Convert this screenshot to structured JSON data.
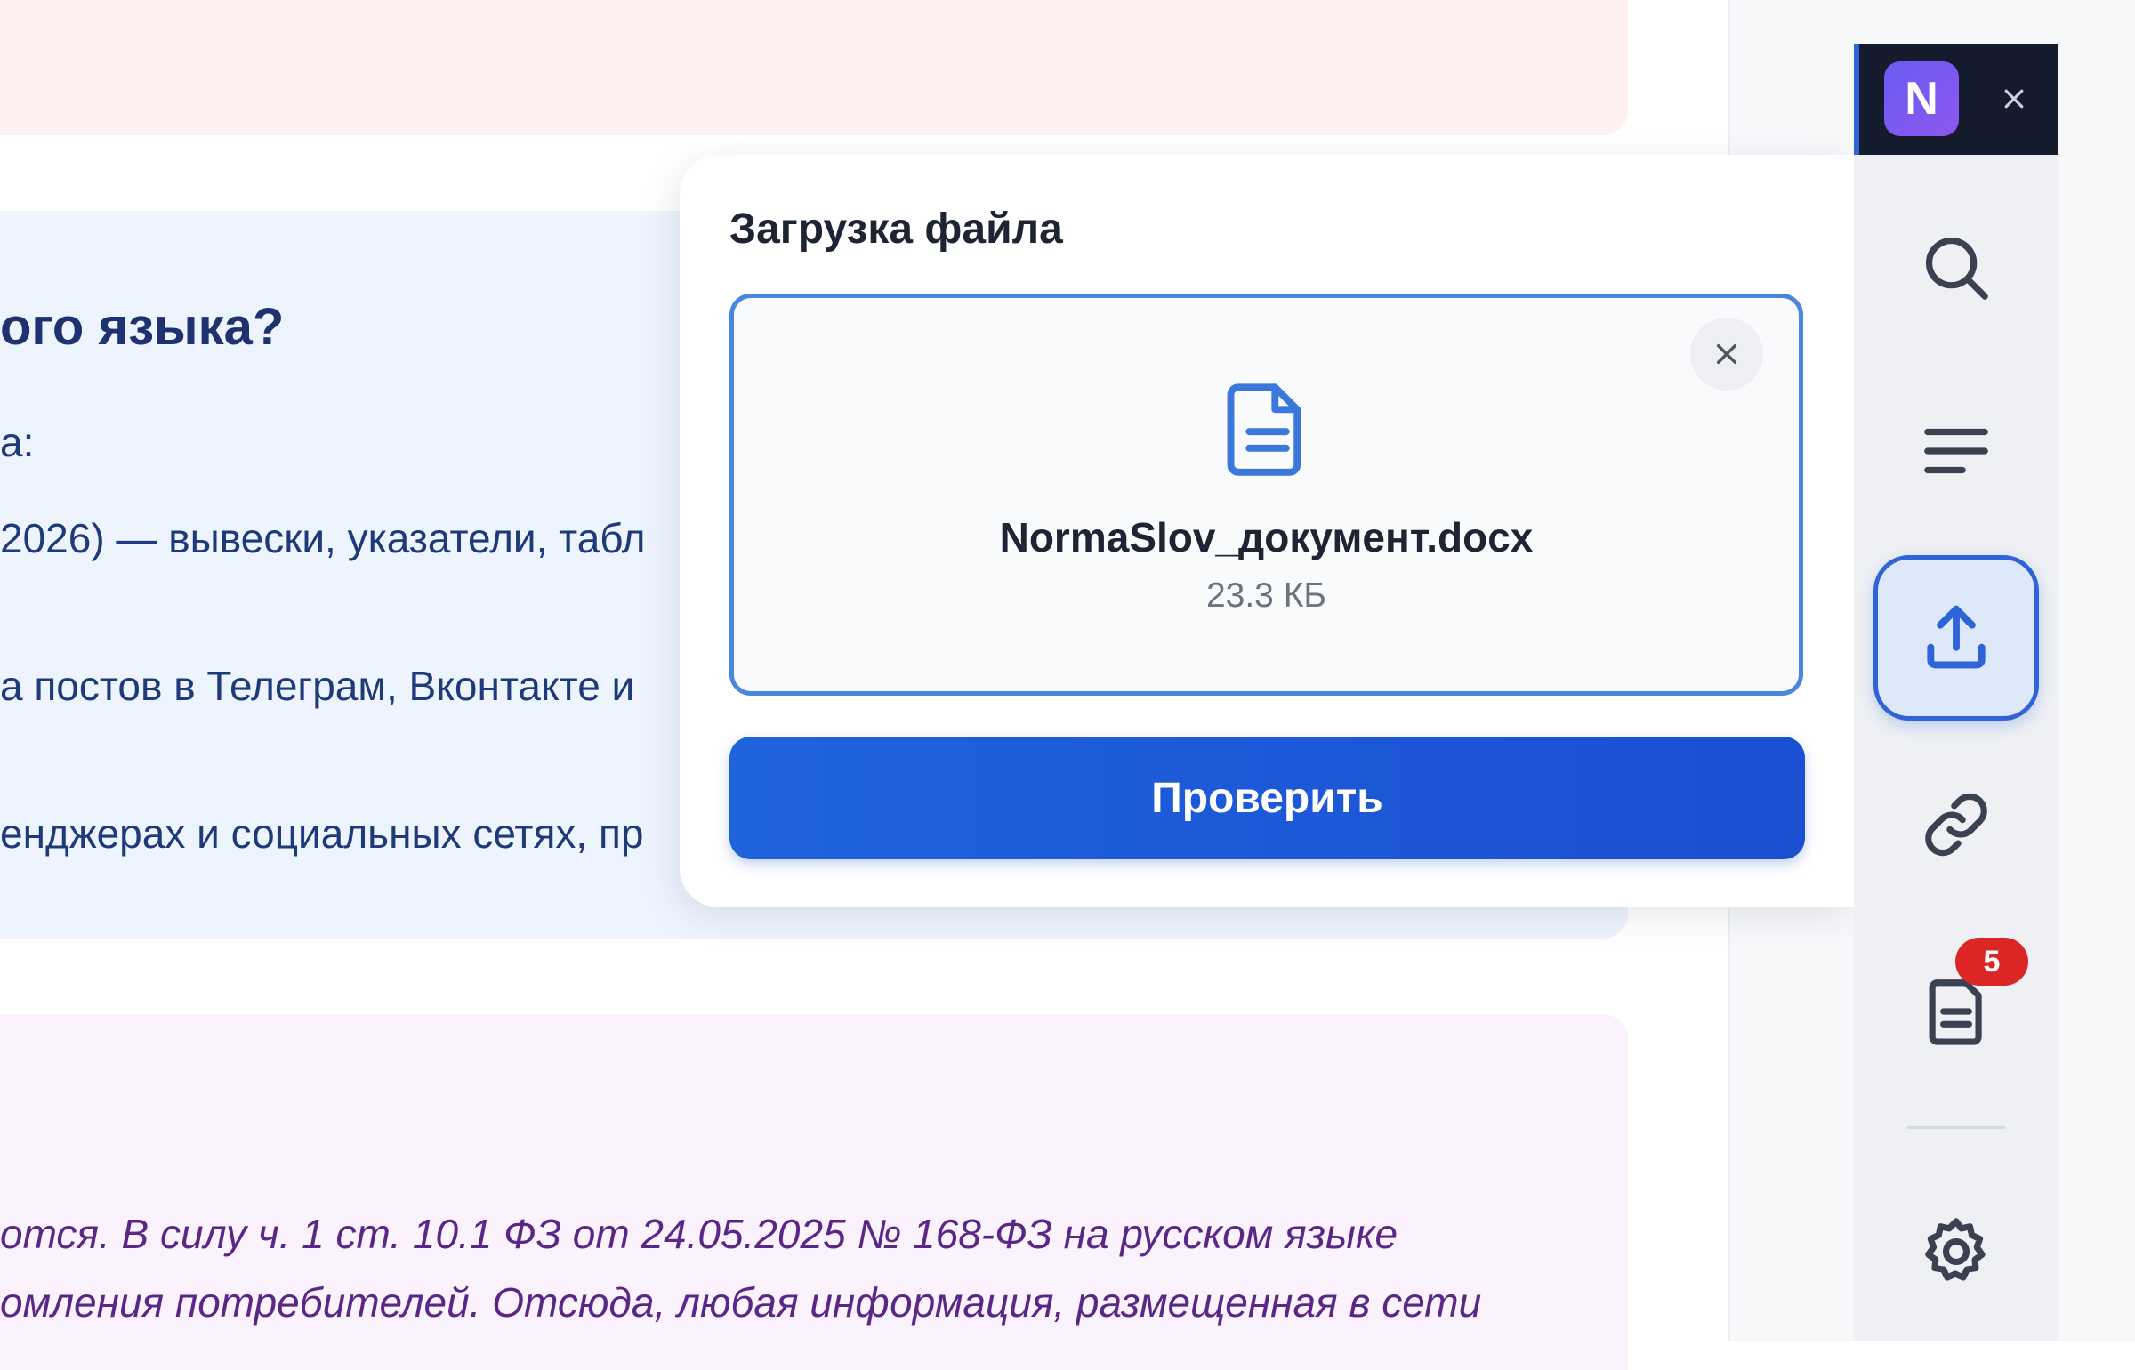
{
  "background_page": {
    "heading": "ого языка?",
    "lines": [
      "а:",
      "2026) — вывески, указатели, табл",
      "а постов в Телеграм, Вконтакте и",
      "енджерах и социальных сетях, пр"
    ],
    "italic_lines": [
      "отся. В силу ч. 1 ст. 10.1 ФЗ от 24.05.2025 № 168-ФЗ на русском языке",
      "омления потребителей. Отсюда, любая информация, размещенная в сети"
    ]
  },
  "upload_popup": {
    "title": "Загрузка файла",
    "file_name": "NormaSlov_документ.docx",
    "file_size": "23.3 КБ",
    "remove_icon": "close-icon",
    "file_icon": "document-icon",
    "check_button_label": "Проверить"
  },
  "extension": {
    "logo_letter": "N",
    "close_icon": "close-icon",
    "rail_items": [
      {
        "name": "search",
        "icon": "search-icon",
        "active": false
      },
      {
        "name": "text",
        "icon": "text-lines-icon",
        "active": false
      },
      {
        "name": "upload",
        "icon": "upload-icon",
        "active": true
      },
      {
        "name": "link",
        "icon": "link-icon",
        "active": false
      },
      {
        "name": "documents",
        "icon": "document-icon",
        "active": false,
        "badge": "5"
      },
      {
        "name": "settings",
        "icon": "gear-icon",
        "active": false
      }
    ],
    "documents_badge": "5"
  },
  "colors": {
    "accent": "#2f63d8",
    "button": "#1f63dd",
    "badge": "#dc2626",
    "rail_header": "#141b2c",
    "heading_text": "#1e3170",
    "italic_text": "#5b2787"
  }
}
